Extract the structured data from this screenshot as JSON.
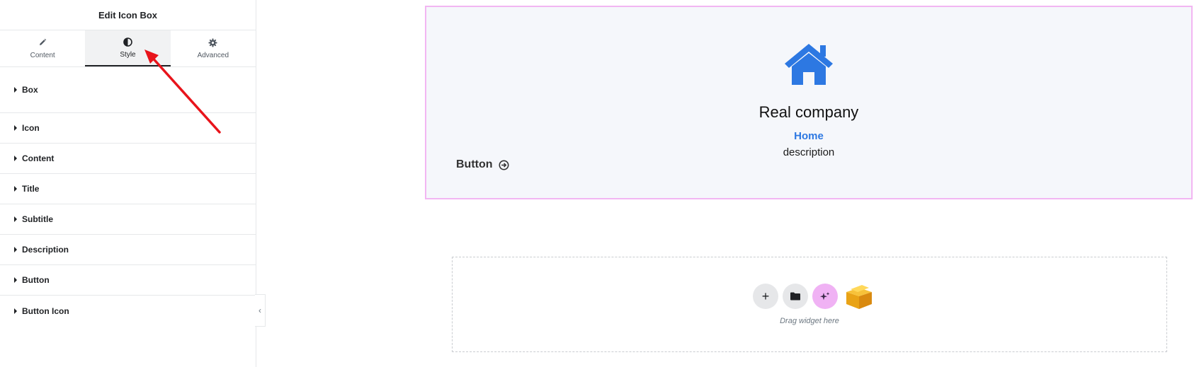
{
  "panel": {
    "title": "Edit Icon Box",
    "tabs": [
      {
        "label": "Content",
        "icon": "pencil-icon"
      },
      {
        "label": "Style",
        "icon": "half-circle-icon",
        "active": true
      },
      {
        "label": "Advanced",
        "icon": "gear-icon"
      }
    ],
    "sections": [
      {
        "label": "Box"
      },
      {
        "label": "Icon"
      },
      {
        "label": "Content"
      },
      {
        "label": "Title"
      },
      {
        "label": "Subtitle"
      },
      {
        "label": "Description"
      },
      {
        "label": "Button"
      },
      {
        "label": "Button Icon"
      }
    ],
    "collapse_chevron": "‹"
  },
  "preview": {
    "icon_box": {
      "icon": "house-icon",
      "title": "Real company",
      "subtitle": "Home",
      "description": "description",
      "button_label": "Button",
      "button_icon": "arrow-circle-right-icon"
    },
    "drop_zone": {
      "add_label": "+",
      "label": "Drag widget here"
    }
  },
  "colors": {
    "accent_blue": "#2d78e2",
    "box_bg": "#f5f7fb",
    "box_border": "#f2b6f2",
    "annotation_arrow": "#e8141b",
    "ai_button": "#f0b2f4"
  }
}
